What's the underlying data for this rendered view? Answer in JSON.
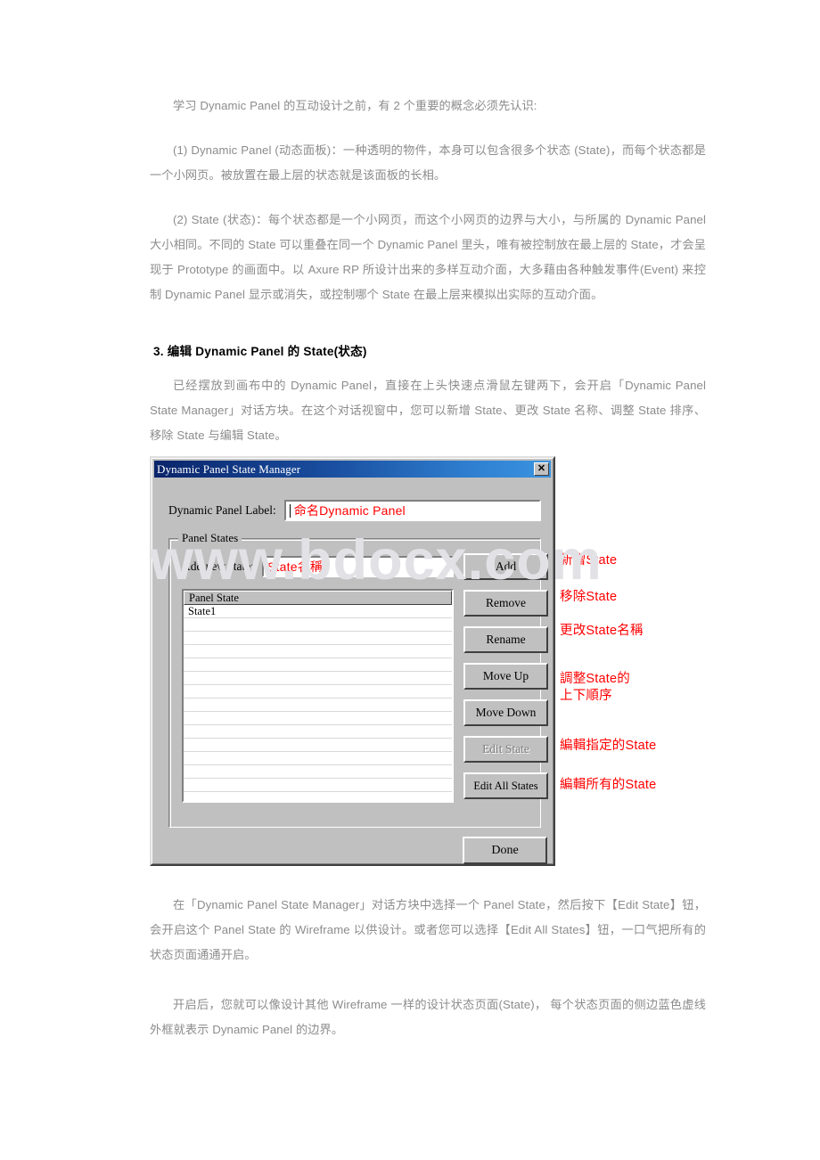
{
  "document": {
    "paragraphs": [
      "学习 Dynamic Panel 的互动设计之前，有 2 个重要的概念必须先认识:",
      "(1) Dynamic Panel (动态面板)：一种透明的物件，本身可以包含很多个状态 (State)，而每个状态都是一个小网页。被放置在最上层的状态就是该面板的长相。",
      "(2) State (状态)：每个状态都是一个小网页，而这个小网页的边界与大小，与所属的 Dynamic Panel 大小相同。不同的 State 可以重叠在同一个 Dynamic Panel 里头，唯有被控制放在最上层的 State，才会呈现于 Prototype 的画面中。以 Axure RP 所设计出来的多样互动介面，大多藉由各种触发事件(Event) 来控制 Dynamic Panel 显示或消失，或控制哪个 State 在最上层来模拟出实际的互动介面。"
    ],
    "section_heading": "3. 编辑 Dynamic Panel  的 State(状态)",
    "paragraph_after_heading": "已经摆放到画布中的 Dynamic Panel，直接在上头快速点滑鼠左键两下，会开启「Dynamic Panel State Manager」对话方块。在这个对话视窗中，您可以新增 State、更改 State 名称、调整 State 排序、移除 State 与编辑 State。",
    "paragraphs_after_figure": [
      "在「Dynamic Panel State Manager」对话方块中选择一个 Panel State，然后按下【Edit State】钮，会开启这个 Panel State 的 Wireframe 以供设计。或者您可以选择【Edit All States】钮，一口气把所有的状态页面通通开启。",
      "开启后，您就可以像设计其他 Wireframe 一样的设计状态页面(State)， 每个状态页面的侧边蓝色虚线外框就表示 Dynamic Panel 的边界。"
    ]
  },
  "watermark": {
    "text": "www.bdocx.com",
    "color": "#e2e2e6"
  },
  "dialog": {
    "title": "Dynamic Panel State Manager",
    "close_glyph": "✕",
    "titlebar_color": "#0a246a",
    "face_color": "#c0c0c0",
    "label_field": {
      "label": "Dynamic Panel Label:",
      "value": "命名Dynamic Panel",
      "value_color": "#ff0000"
    },
    "groupbox": {
      "title": "Panel States",
      "add_field": {
        "label": "Add new state:",
        "value": "State名稱",
        "value_color": "#ff0000"
      },
      "list": {
        "header": "Panel State",
        "rows": [
          "State1",
          "",
          "",
          "",
          "",
          "",
          "",
          "",
          "",
          "",
          "",
          "",
          "",
          "",
          ""
        ]
      },
      "buttons": [
        {
          "label": "Add",
          "disabled": false
        },
        {
          "label": "Remove",
          "disabled": false
        },
        {
          "label": "Rename",
          "disabled": false
        },
        {
          "label": "Move Up",
          "disabled": false
        },
        {
          "label": "Move Down",
          "disabled": false
        },
        {
          "label": "Edit State",
          "disabled": true
        },
        {
          "label": "Edit All States",
          "disabled": false
        }
      ]
    },
    "done_button": "Done"
  },
  "annotations": {
    "color": "#ff0000",
    "add": "新增State",
    "remove": "移除State",
    "rename": "更改State名稱",
    "move": "調整State的\n上下順序",
    "edit_state": "編輯指定的State",
    "edit_all": "編輯所有的State"
  }
}
